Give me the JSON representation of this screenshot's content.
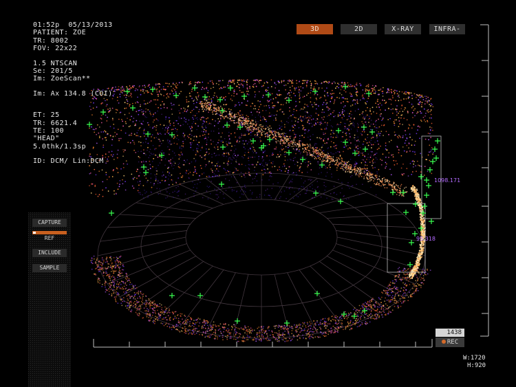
{
  "info": {
    "datetime": "01:52p  05/13/2013",
    "patient": "PATIENT: ZOE",
    "tr_top": "TR: 8002",
    "fov": "FOV: 22x22",
    "ntscan": "1.5 NTSCAN",
    "se": "Se: 201/5",
    "im": "Im: ZoeScan**",
    "im_ax": "Im: Ax 134.8 (COI)",
    "et": "ET: 25",
    "tr": "TR: 6621.4",
    "te": "TE: 100",
    "region": "\"HEAD\"",
    "thk": "5.0thk/1.3sp",
    "id": "ID: DCM/ Lin:DCM"
  },
  "modes": [
    {
      "label": "3D",
      "active": true
    },
    {
      "label": "2D",
      "active": false
    },
    {
      "label": "X-RAY",
      "active": false
    },
    {
      "label": "INFRA-",
      "active": false
    }
  ],
  "side_buttons": {
    "capture": "CAPTURE",
    "ref": "REF",
    "include": "INCLUDE",
    "sample": "SAMPLE"
  },
  "measure_labels": {
    "upper": "1098.171",
    "lower": "95.318"
  },
  "counter": "1438",
  "rec_label": "REC",
  "dims": {
    "w": "W:1720",
    "h": "H:920"
  },
  "colors": {
    "accent": "#b04a16",
    "marker": "#39ff4f",
    "measure": "#b46cff"
  }
}
